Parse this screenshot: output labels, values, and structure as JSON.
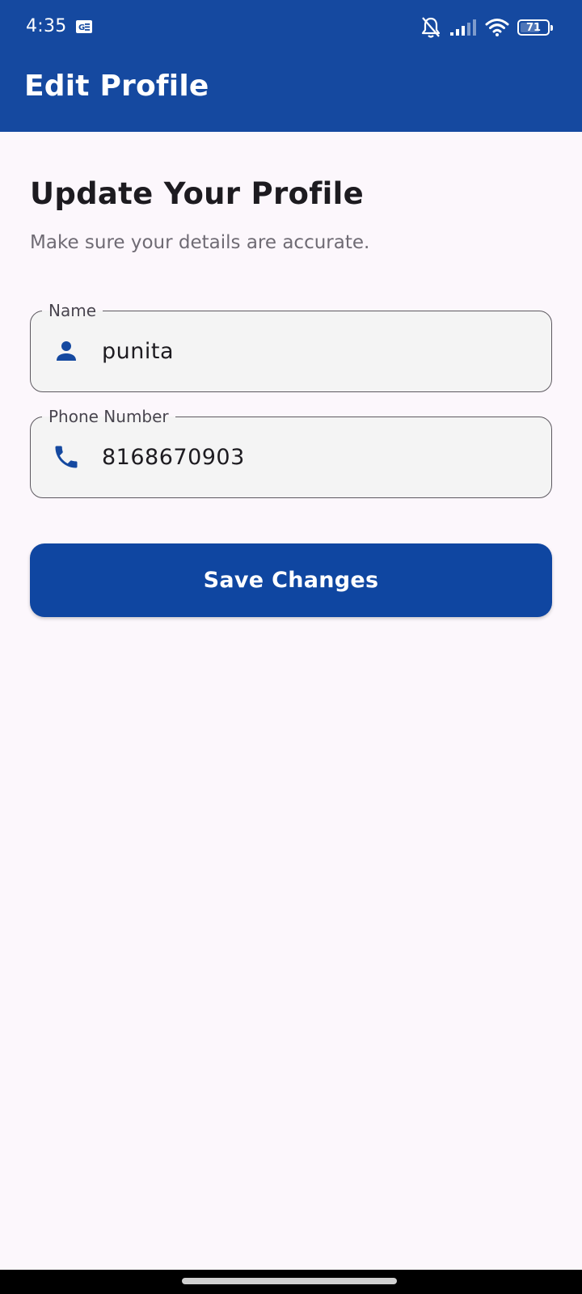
{
  "status_bar": {
    "time": "4:35",
    "battery_level": "71",
    "icons": [
      "gmail-icon",
      "bell-off-icon",
      "signal-icon",
      "wifi-icon",
      "battery-icon"
    ]
  },
  "app_bar": {
    "title": "Edit Profile",
    "color": "#1549a0"
  },
  "main": {
    "heading": "Update Your Profile",
    "subheading": "Make sure your details are accurate.",
    "fields": [
      {
        "label": "Name",
        "value": "punita",
        "icon": "person-icon"
      },
      {
        "label": "Phone Number",
        "value": "8168670903",
        "icon": "phone-icon"
      }
    ],
    "save_button_label": "Save Changes",
    "accent_color": "#0f46a1"
  }
}
